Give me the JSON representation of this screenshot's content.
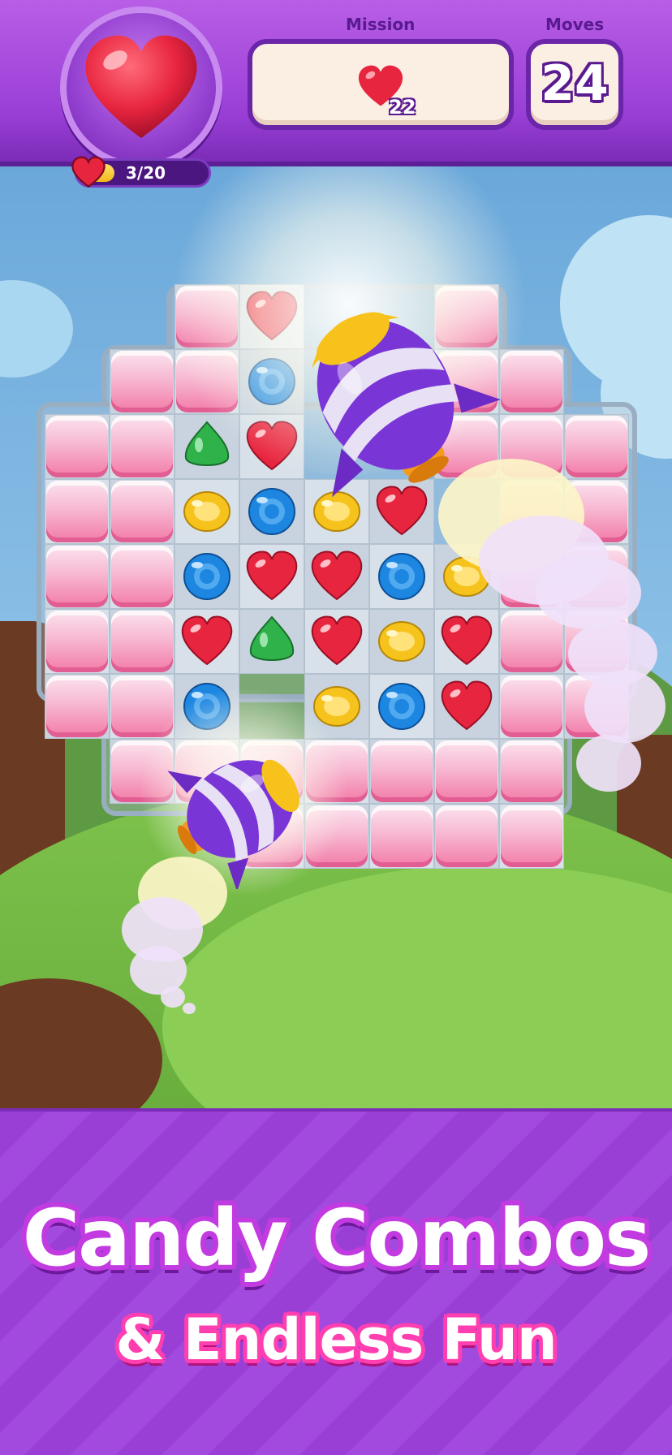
{
  "hud": {
    "goal_icon": "heart-icon",
    "progress_text": "3/20",
    "progress_fraction": 0.15,
    "mission_label": "Mission",
    "mission_icon": "heart-icon",
    "mission_count": "22",
    "moves_label": "Moves",
    "moves_count": "24"
  },
  "board": {
    "candy_types": {
      "R": "red-heart-candy",
      "G": "green-drop-candy",
      "Y": "yellow-lemon-candy",
      "B": "blue-round-candy"
    },
    "colors": {
      "red": "#e8253f",
      "green": "#2fb24a",
      "yellow": "#f6c21c",
      "blue": "#1d86e0",
      "marshmallow": "#f48cb5"
    },
    "boosters": [
      "rocket-booster",
      "rocket-booster"
    ]
  },
  "banner": {
    "title_line1": "Candy Combos",
    "title_line2": "& Endless Fun"
  }
}
